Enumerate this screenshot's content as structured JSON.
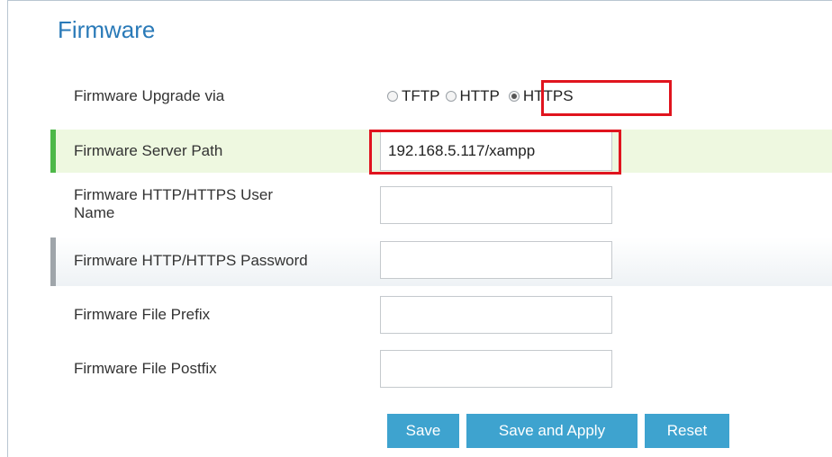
{
  "section": {
    "title": "Firmware"
  },
  "fields": {
    "upgrade_via": {
      "label": "Firmware Upgrade via",
      "options": [
        "TFTP",
        "HTTP",
        "HTTPS"
      ],
      "selected": "HTTPS"
    },
    "server_path": {
      "label": "Firmware Server Path",
      "value": "192.168.5.117/xampp"
    },
    "user_name": {
      "label_line1": "Firmware HTTP/HTTPS User",
      "label_line2": "Name",
      "value": ""
    },
    "password": {
      "label": "Firmware HTTP/HTTPS Password",
      "value": ""
    },
    "file_prefix": {
      "label": "Firmware File Prefix",
      "value": ""
    },
    "file_postfix": {
      "label": "Firmware File Postfix",
      "value": ""
    }
  },
  "buttons": {
    "save": "Save",
    "save_apply": "Save and Apply",
    "reset": "Reset"
  },
  "colors": {
    "title": "#2a7ab8",
    "button_bg": "#3ea3cf",
    "highlight_green": "#4db848",
    "annotation_red": "#e0141e"
  }
}
